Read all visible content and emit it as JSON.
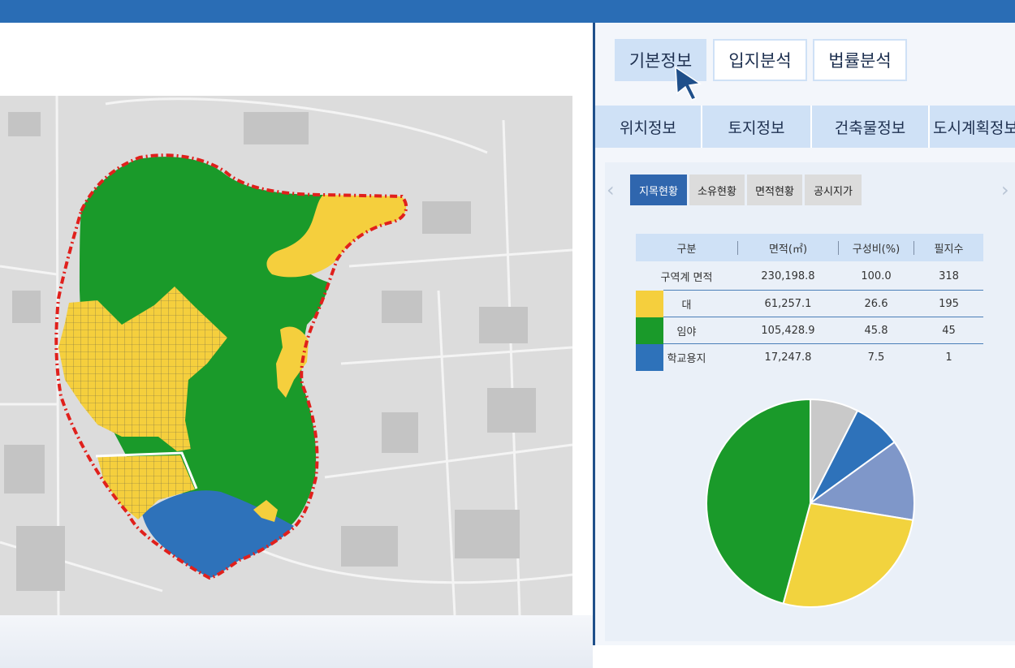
{
  "tabs_primary": [
    {
      "label": "기본정보",
      "active": true
    },
    {
      "label": "입지분석",
      "active": false
    },
    {
      "label": "법률분석",
      "active": false
    }
  ],
  "tabs_secondary": [
    "위치정보",
    "토지정보",
    "건축물정보",
    "도시계획정보"
  ],
  "tabs_tertiary": [
    {
      "label": "지목현황",
      "active": true
    },
    {
      "label": "소유현황",
      "active": false
    },
    {
      "label": "면적현황",
      "active": false
    },
    {
      "label": "공시지가",
      "active": false
    }
  ],
  "nav": {
    "prev_icon": "chevron-left-icon",
    "next_icon": "chevron-right-icon"
  },
  "table": {
    "headers": [
      "구분",
      "면적(㎡)",
      "구성비(%)",
      "필지수"
    ],
    "total": {
      "label": "구역계 면적",
      "area": "230,198.8",
      "ratio": "100.0",
      "count": "318"
    },
    "rows": [
      {
        "label": "대",
        "area": "61,257.1",
        "ratio": "26.6",
        "count": "195",
        "color": "#f5cf3d"
      },
      {
        "label": "임야",
        "area": "105,428.9",
        "ratio": "45.8",
        "count": "45",
        "color": "#1a9a2a"
      },
      {
        "label": "학교용지",
        "area": "17,247.8",
        "ratio": "7.5",
        "count": "1",
        "color": "#2e72ba"
      }
    ]
  },
  "chart_data": {
    "type": "pie",
    "slices": [
      {
        "value": 7.5,
        "color": "#c9c9c9"
      },
      {
        "value": 7.5,
        "color": "#2e72ba"
      },
      {
        "value": 12.6,
        "color": "#7f97c9"
      },
      {
        "value": 26.6,
        "color": "#f2d33e"
      },
      {
        "value": 45.8,
        "color": "#1a9a2a"
      }
    ]
  },
  "map": {
    "land_colors": {
      "forest": "#1a9a2a",
      "residential": "#f5cf3d",
      "school": "#2e72ba",
      "boundary": "#e0201c"
    }
  },
  "colors": {
    "topbar": "#2a6db5",
    "accent": "#2f66ae",
    "tab_bg": "#cfe1f6"
  }
}
